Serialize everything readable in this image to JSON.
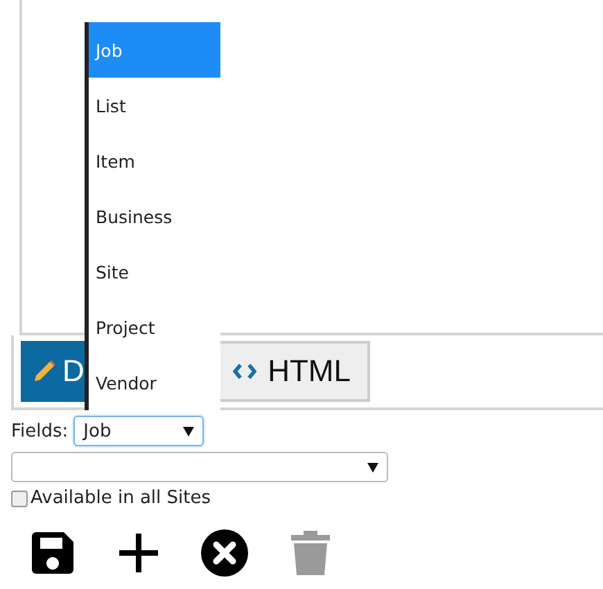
{
  "editor_tabs": [
    {
      "kind": "design",
      "label": "D",
      "selected": true
    },
    {
      "kind": "html",
      "label": "HTML",
      "selected": false
    }
  ],
  "fields": {
    "label": "Fields:",
    "value": "Job",
    "open": true,
    "options": [
      {
        "label": "Job",
        "selected": true
      },
      {
        "label": "List",
        "selected": false
      },
      {
        "label": "Item",
        "selected": false
      },
      {
        "label": "Business",
        "selected": false
      },
      {
        "label": "Site",
        "selected": false
      },
      {
        "label": "Project",
        "selected": false
      },
      {
        "label": "Vendor",
        "selected": false
      }
    ]
  },
  "available_in_all_sites": {
    "label": "Available in all Sites",
    "checked": false
  },
  "toolbar": [
    {
      "kind": "save",
      "disabled": false
    },
    {
      "kind": "add",
      "disabled": false
    },
    {
      "kind": "cancel",
      "disabled": false
    },
    {
      "kind": "delete",
      "disabled": true
    }
  ]
}
